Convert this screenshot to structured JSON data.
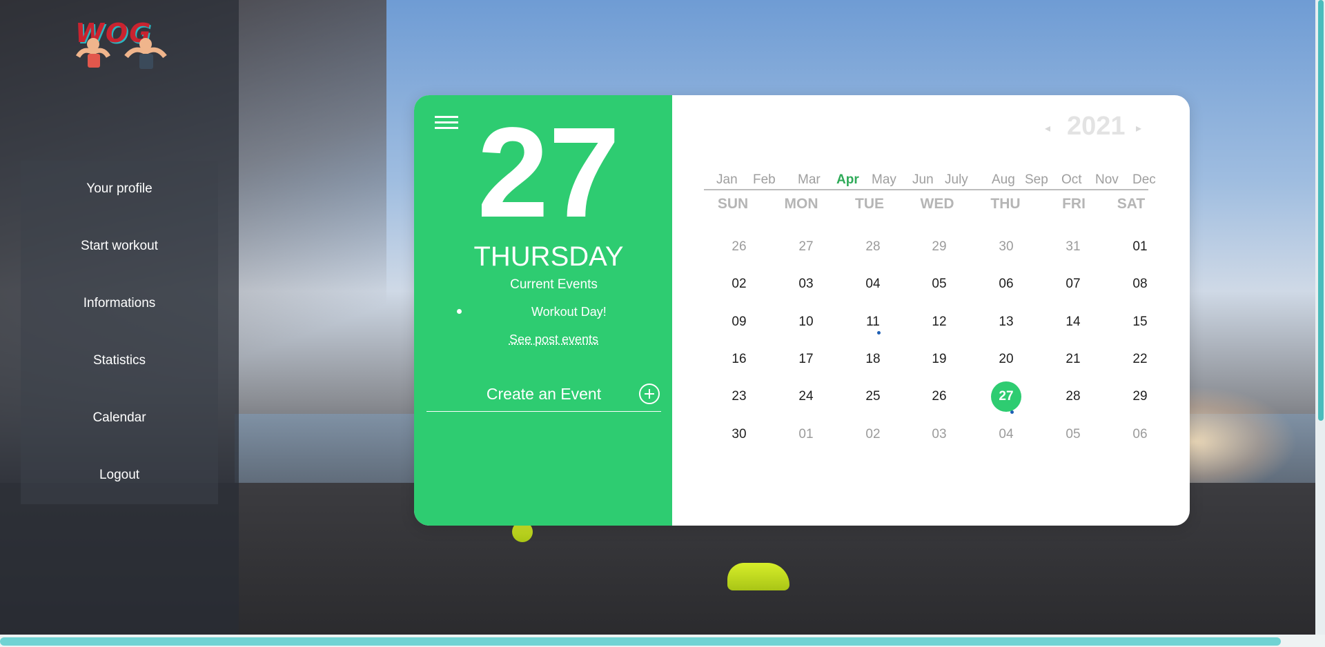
{
  "brand": {
    "logo_text": "WOG"
  },
  "sidebar": {
    "items": [
      {
        "label": "Your profile"
      },
      {
        "label": "Start workout"
      },
      {
        "label": "Informations"
      },
      {
        "label": "Statistics"
      },
      {
        "label": "Calendar"
      },
      {
        "label": "Logout"
      }
    ]
  },
  "calendar": {
    "selected_day": "27",
    "selected_weekday": "THURSDAY",
    "current_events_label": "Current Events",
    "events": [
      "Workout Day!"
    ],
    "past_events_link": "See post events",
    "create_event_label": "Create an Event",
    "year": "2021",
    "prev_arrow": "◂",
    "next_arrow": "▸",
    "months": [
      "Jan",
      "Feb",
      "Mar",
      "Apr",
      "May",
      "Jun",
      "July",
      "Aug",
      "Sep",
      "Oct",
      "Nov",
      "Dec"
    ],
    "active_month": "Apr",
    "weekdays": [
      "SUN",
      "MON",
      "TUE",
      "WED",
      "THU",
      "FRI",
      "SAT"
    ],
    "weeks": [
      [
        "26",
        "27",
        "28",
        "29",
        "30",
        "31",
        "01"
      ],
      [
        "02",
        "03",
        "04",
        "05",
        "06",
        "07",
        "08"
      ],
      [
        "09",
        "10",
        "11",
        "12",
        "13",
        "14",
        "15"
      ],
      [
        "16",
        "17",
        "18",
        "19",
        "20",
        "21",
        "22"
      ],
      [
        "23",
        "24",
        "25",
        "26",
        "27",
        "28",
        "29"
      ],
      [
        "30",
        "01",
        "02",
        "03",
        "04",
        "05",
        "06"
      ]
    ]
  },
  "colors": {
    "accent": "#2ecc71",
    "active_month": "#2eaa58",
    "event_dot": "#1e5fb4"
  }
}
